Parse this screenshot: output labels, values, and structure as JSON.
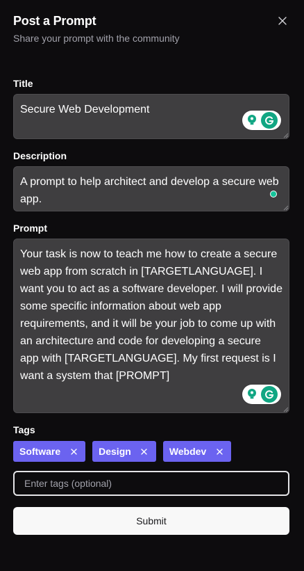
{
  "header": {
    "title": "Post a Prompt",
    "subtitle": "Share your prompt with the community",
    "close_icon": "close-icon"
  },
  "form": {
    "title": {
      "label": "Title",
      "value": "Secure Web Development"
    },
    "description": {
      "label": "Description",
      "value": "A prompt to help architect and develop a secure web app."
    },
    "prompt": {
      "label": "Prompt",
      "value": "Your task is now to teach me how to create a secure web app from scratch in [TARGETLANGUAGE]. I want you to act as a software developer. I will provide some specific information about web app requirements, and it will be your job to come up with an architecture and code for developing a secure app with [TARGETLANGUAGE]. My first request is I want a system that [PROMPT]"
    },
    "tags": {
      "label": "Tags",
      "items": [
        {
          "label": "Software"
        },
        {
          "label": "Design"
        },
        {
          "label": "Webdev"
        }
      ],
      "input_placeholder": "Enter tags (optional)",
      "input_value": ""
    },
    "submit_label": "Submit"
  },
  "colors": {
    "background": "#0d0c0e",
    "field_bg": "#3f3e40",
    "tag_bg": "#6b63f0",
    "grammarly_green": "#15c39a"
  },
  "icons": {
    "grammarly_badge": "grammarly-g-icon",
    "grammarly_tone": "lightbulb-icon",
    "tag_remove": "close-icon"
  }
}
